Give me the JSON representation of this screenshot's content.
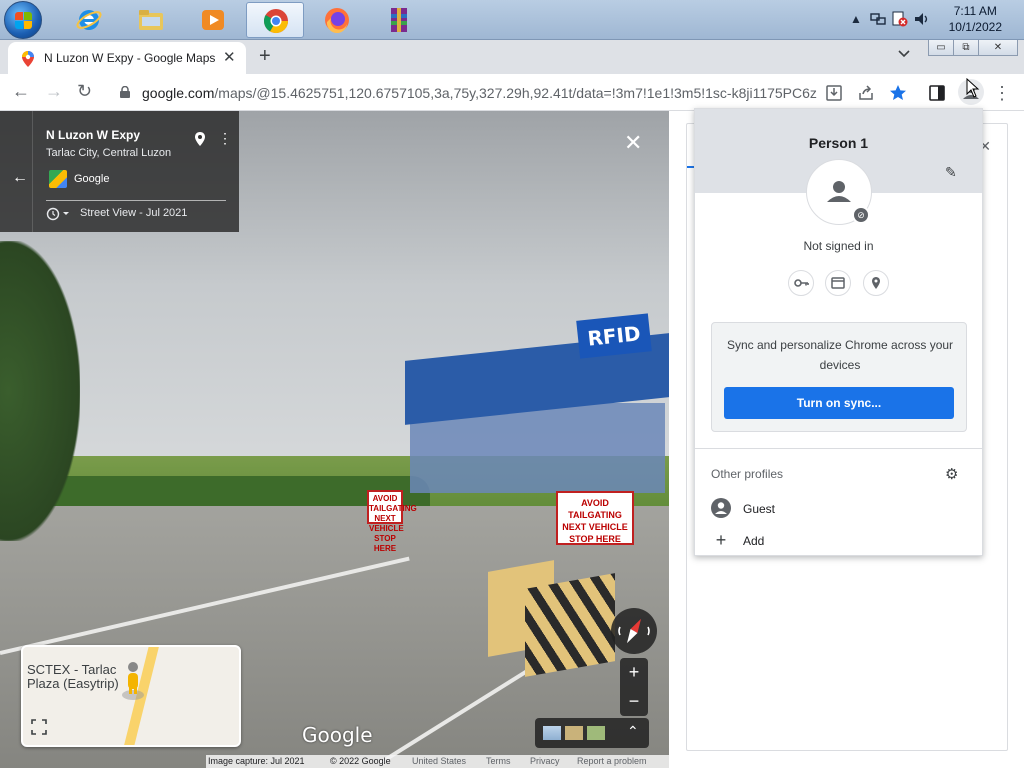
{
  "taskbar": {
    "clock_time": "7:11 AM",
    "clock_date": "10/1/2022",
    "apps": [
      "Internet Explorer",
      "Windows Explorer",
      "Windows Media Player",
      "Google Chrome",
      "Firefox",
      "WinRAR"
    ]
  },
  "tab": {
    "title": "N Luzon W Expy - Google Maps",
    "close_glyph": "✕",
    "new_tab_glyph": "+",
    "dropdown_glyph": "⌄"
  },
  "window_controls": {
    "minimize": "▭",
    "restore": "⧉",
    "close": "✕"
  },
  "toolbar": {
    "back": "←",
    "forward": "→",
    "reload": "↻",
    "url_host": "google.com",
    "url_path": "/maps/@15.4625751,120.6757105,3a,75y,327.29h,92.41t/data=!3m7!1e1!3m5!1sc-k8ji1175PC6z...",
    "menu": "⋮"
  },
  "streetview": {
    "title": "N Luzon W Expy",
    "subtitle": "Tarlac City, Central Luzon",
    "provider": "Google",
    "date_label": "Street View - Jul 2021",
    "back_glyph": "←",
    "close_glyph": "✕",
    "more_glyph": "⋮",
    "sign_rfid": "RFID",
    "sign_1": "AVOID TAILGATING NEXT VEHICLE STOP HERE",
    "sign_2": "AVOID TAILGATING NEXT VEHICLE STOP HERE",
    "minimap_label_line1": "SCTEX - Tarlac",
    "minimap_label_line2": "Plaza (Easytrip)",
    "zoom_in": "+",
    "zoom_out": "−",
    "layers_chevron": "⌃",
    "logo": "Google",
    "footer": {
      "capture": "Image capture: Jul 2021",
      "copyright": "© 2022 Google",
      "country": "United States",
      "terms": "Terms",
      "privacy": "Privacy",
      "report": "Report a problem"
    }
  },
  "side_panel": {
    "close_glyph": "✕"
  },
  "profile": {
    "name": "Person 1",
    "status": "Not signed in",
    "sync_text": "Sync and personalize Chrome across your devices",
    "sync_button": "Turn on sync...",
    "other_profiles": "Other profiles",
    "guest": "Guest",
    "add": "Add",
    "edit_glyph": "✎",
    "gear_glyph": "⚙",
    "add_glyph": "+"
  },
  "colors": {
    "accent": "#1a73e8",
    "taskbar": "#b9cde3",
    "tabstrip": "#dee1e6"
  }
}
